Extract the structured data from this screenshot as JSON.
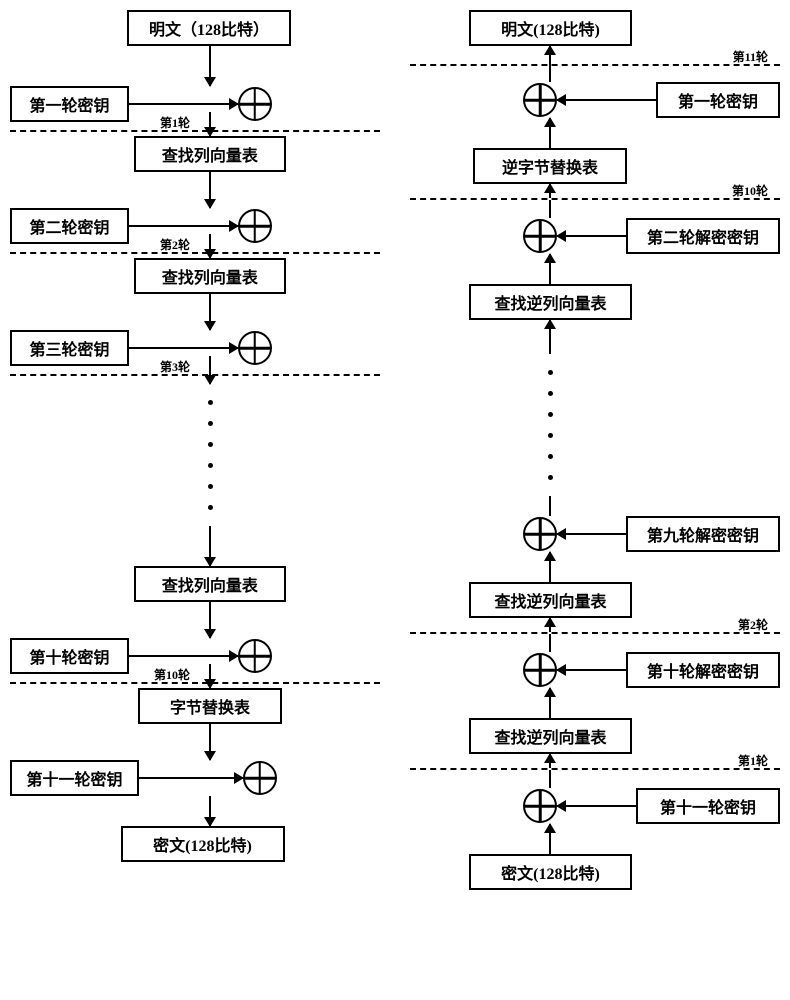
{
  "left": {
    "title": "明文（128比特）",
    "keys": [
      "第一轮密钥",
      "第二轮密钥",
      "第三轮密钥",
      "第十轮密钥",
      "第十一轮密钥"
    ],
    "op_lookup": "查找列向量表",
    "op_sub": "字节替换表",
    "cipher": "密文(128比特)",
    "rounds": [
      "第1轮",
      "第2轮",
      "第3轮",
      "第10轮"
    ]
  },
  "right": {
    "title": "明文(128比特)",
    "keys": [
      "第一轮密钥",
      "第二轮解密密钥",
      "第九轮解密密钥",
      "第十轮解密密钥",
      "第十一轮密钥"
    ],
    "op_lookup": "查找逆列向量表",
    "op_sub": "逆字节替换表",
    "cipher": "密文(128比特)",
    "rounds": [
      "第11轮",
      "第10轮",
      "第2轮",
      "第1轮"
    ]
  }
}
